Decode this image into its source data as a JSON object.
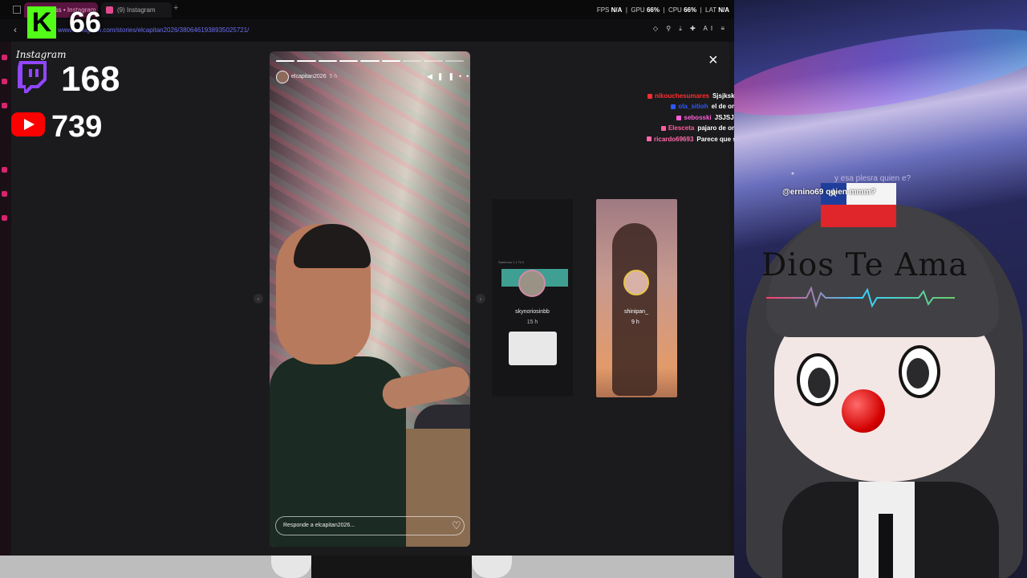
{
  "browser": {
    "tabs": [
      {
        "label": "(9) ...ss • Instagram"
      },
      {
        "label": "(9) Instagram"
      }
    ],
    "new_tab_label": "+",
    "stats": {
      "fps_label": "FPS",
      "fps": "N/A",
      "gpu_label": "GPU",
      "gpu": "66%",
      "cpu_label": "CPU",
      "cpu": "66%",
      "lat_label": "LAT",
      "lat": "N/A"
    },
    "url": "www.instagram.com/stories/elcapitan2026/3806461938935025721/",
    "back_icon": "back-arrow-icon"
  },
  "story": {
    "username": "elcapitan2026",
    "age": "5 h",
    "reply_placeholder": "Responde a elcapitan2026...",
    "progress_segments": 9,
    "progress_done": 6
  },
  "close_label": "×",
  "previews": [
    {
      "username": "skynoriosinbb",
      "time": "15 h",
      "ring_color": "#d28aa4"
    },
    {
      "username": "shinipan_",
      "time": "9 h",
      "ring_color": "#e8c44c"
    }
  ],
  "viewers": {
    "kick_logo": "K",
    "kick": "66",
    "instagram_label": "Instagram",
    "twitch": "168",
    "youtube": "739"
  },
  "chat": [
    {
      "user": "nikouchesumares",
      "msg": "Sjsjksks",
      "color": "#ff2d2d"
    },
    {
      "user": "ola_sitioh",
      "msg": "el de oro",
      "color": "#2b58ff"
    },
    {
      "user": "sebosski",
      "msg": "JSJSJS",
      "color": "#ff5fd8"
    },
    {
      "user": "Elesceta",
      "msg": "pajaro de oro",
      "color": "#ff5fa0"
    },
    {
      "user": "ricardo69693",
      "msg": "Parece que si",
      "color": "#ff6aa8"
    }
  ],
  "vtuber": {
    "mention": "@ernino69",
    "mention_msg": "quien mmm?",
    "question": "y esa plesra quien e?",
    "banner": "Dios Te Ama"
  },
  "colors": {
    "accent": "#d8236f",
    "kick_green": "#53fc18",
    "twitch_purple": "#9146ff",
    "youtube_red": "#ff0000"
  }
}
